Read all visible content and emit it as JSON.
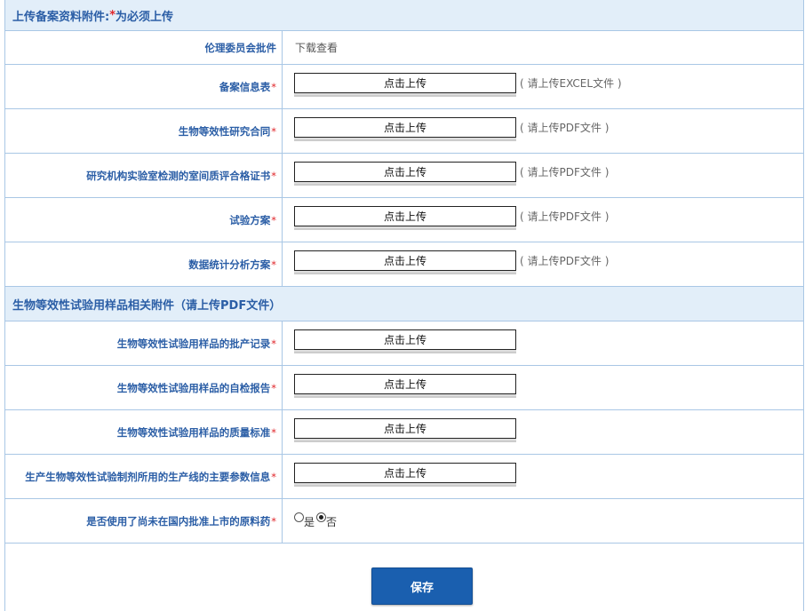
{
  "section1": {
    "title": "上传备案资料附件:",
    "required_mark": "*",
    "title_suffix": "为必须上传"
  },
  "section2": {
    "title": "生物等效性试验用样品相关附件（请上传PDF文件）"
  },
  "ethics_row": {
    "label": "伦理委员会批件",
    "link": "下载查看"
  },
  "upload_label": "点击上传",
  "required_mark": "*",
  "rows1": [
    {
      "label": "备案信息表",
      "hint": "( 请上传EXCEL文件 )"
    },
    {
      "label": "生物等效性研究合同",
      "hint": "( 请上传PDF文件 )"
    },
    {
      "label": "研究机构实验室检测的室间质评合格证书",
      "hint": "( 请上传PDF文件 )"
    },
    {
      "label": "试验方案",
      "hint": "( 请上传PDF文件 )"
    },
    {
      "label": "数据统计分析方案",
      "hint": "( 请上传PDF文件 )"
    }
  ],
  "rows2": [
    {
      "label": "生物等效性试验用样品的批产记录"
    },
    {
      "label": "生物等效性试验用样品的自检报告"
    },
    {
      "label": "生物等效性试验用样品的质量标准"
    },
    {
      "label": "生产生物等效性试验制剂所用的生产线的主要参数信息"
    }
  ],
  "radio_row": {
    "label": "是否使用了尚未在国内批准上市的原料药",
    "options": [
      {
        "label": "是",
        "checked": false
      },
      {
        "label": "否",
        "checked": true
      }
    ]
  },
  "save_button": "保存"
}
